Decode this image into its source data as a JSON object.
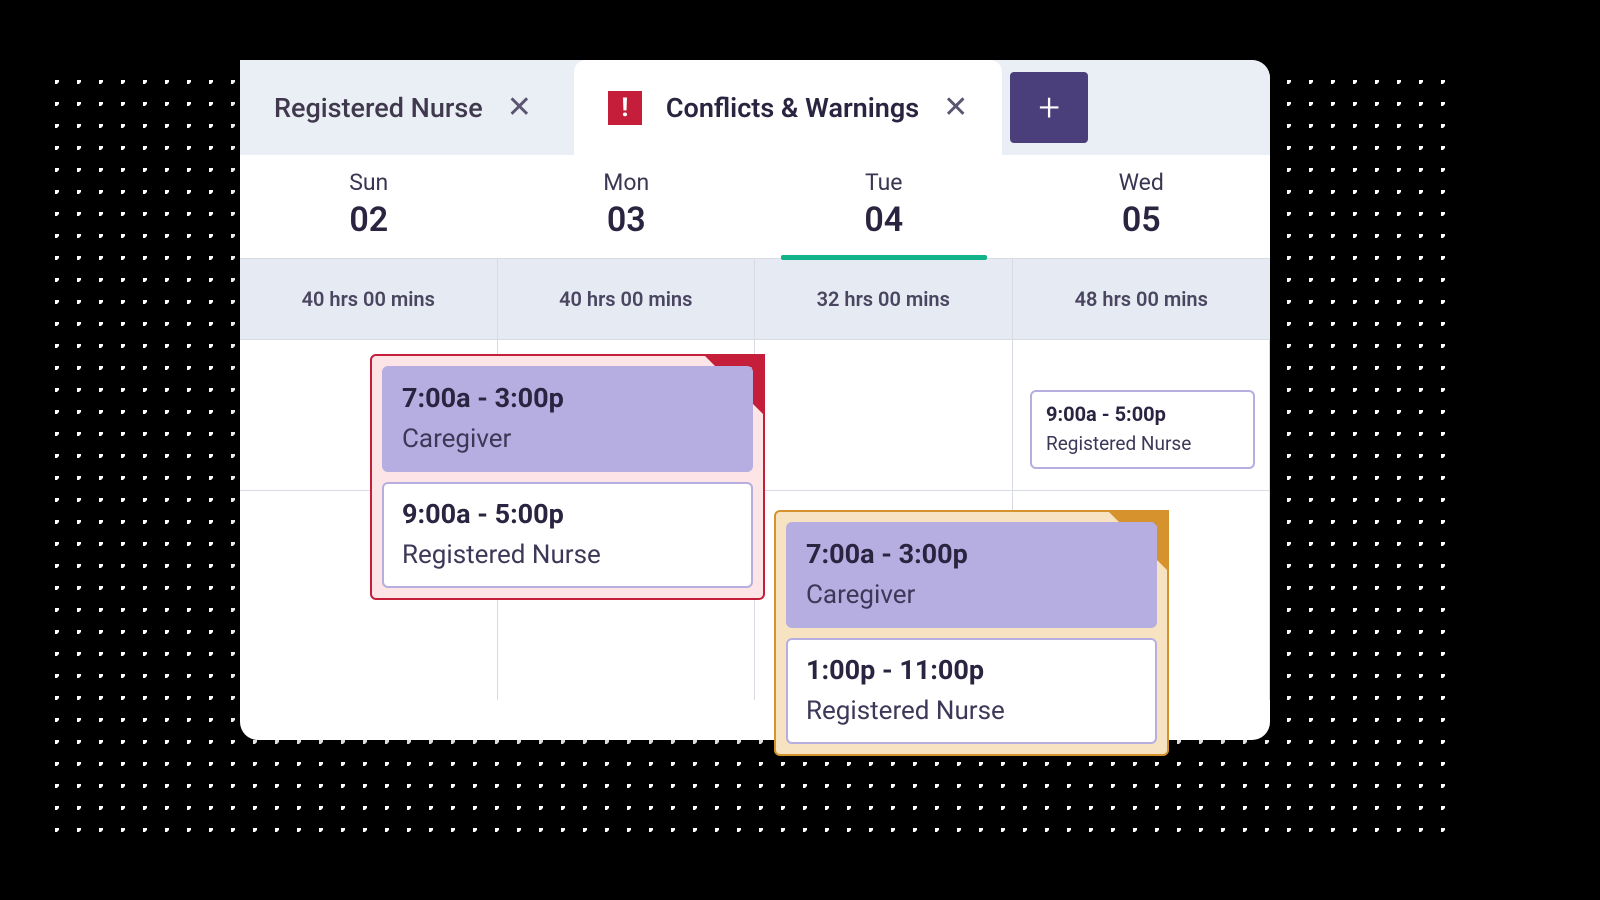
{
  "tabs": {
    "inactive_label": "Registered Nurse",
    "active_label": "Conflicts & Warnings"
  },
  "days": [
    {
      "name": "Sun",
      "num": "02",
      "hours": "40 hrs 00 mins",
      "today": false
    },
    {
      "name": "Mon",
      "num": "03",
      "hours": "40 hrs 00 mins",
      "today": false
    },
    {
      "name": "Tue",
      "num": "04",
      "hours": "32 hrs 00 mins",
      "today": true
    },
    {
      "name": "Wed",
      "num": "05",
      "hours": "48 hrs 00 mins",
      "today": false
    }
  ],
  "shifts": {
    "red_group": {
      "a": {
        "time": "7:00a - 3:00p",
        "role": "Caregiver"
      },
      "b": {
        "time": "9:00a - 5:00p",
        "role": "Registered Nurse"
      }
    },
    "orange_group": {
      "a": {
        "time": "7:00a - 3:00p",
        "role": "Caregiver"
      },
      "b": {
        "time": "1:00p - 11:00p",
        "role": "Registered Nurse"
      }
    },
    "wed_card": {
      "time": "9:00a - 5:00p",
      "role": "Registered Nurse"
    }
  }
}
